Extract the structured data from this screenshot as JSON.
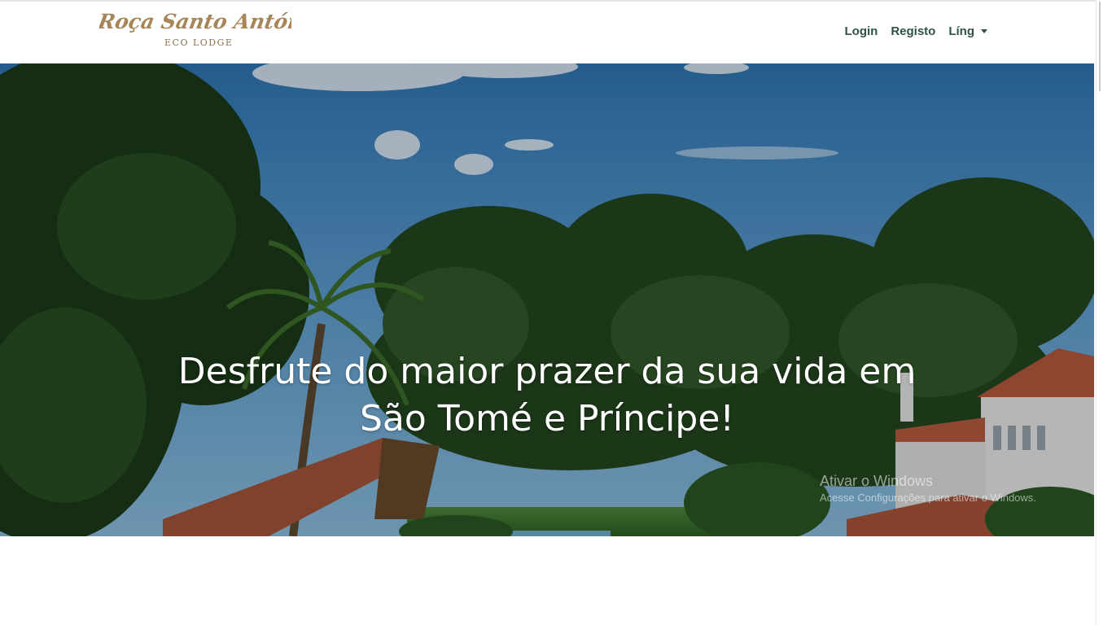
{
  "brand": {
    "name": "Roça Santo António",
    "subtitle": "ECO LODGE"
  },
  "nav": {
    "login": "Login",
    "register": "Registo",
    "language": "Líng"
  },
  "hero": {
    "title_line1": "Desfrute do maior prazer da sua vida em",
    "title_line2": "São Tomé e Príncipe!"
  },
  "watermark": {
    "title": "Ativar o Windows",
    "subtitle": "Acesse Configurações para ativar o Windows."
  },
  "colors": {
    "nav_text": "#2f5247",
    "brand_gold": "#8a7250"
  }
}
